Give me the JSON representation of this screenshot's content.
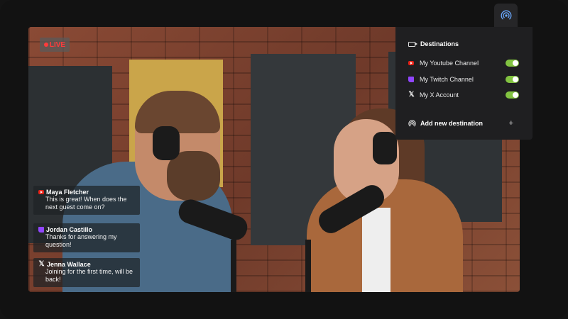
{
  "stage": {
    "live_label": "LIVE"
  },
  "chat": [
    {
      "platform": "youtube",
      "name": "Maya Fletcher",
      "message": "This is great! When does the next guest come on?"
    },
    {
      "platform": "twitch",
      "name": "Jordan Castillo",
      "message": "Thanks for answering my question!"
    },
    {
      "platform": "x",
      "name": "Jenna Wallace",
      "message": "Joining for the first time, will be back!"
    }
  ],
  "destinations": {
    "title": "Destinations",
    "items": [
      {
        "platform": "youtube",
        "label": "My Youtube Channel",
        "enabled": true
      },
      {
        "platform": "twitch",
        "label": "My Twitch Channel",
        "enabled": true
      },
      {
        "platform": "x",
        "label": "My X Account",
        "enabled": true
      }
    ],
    "add_label": "Add new destination",
    "add_symbol": "+"
  },
  "colors": {
    "toggle_on": "#82c341",
    "live_red": "#ff3b3b",
    "youtube": "#e62117",
    "twitch": "#9146ff"
  },
  "icons": {
    "x_glyph": "𝕏"
  }
}
